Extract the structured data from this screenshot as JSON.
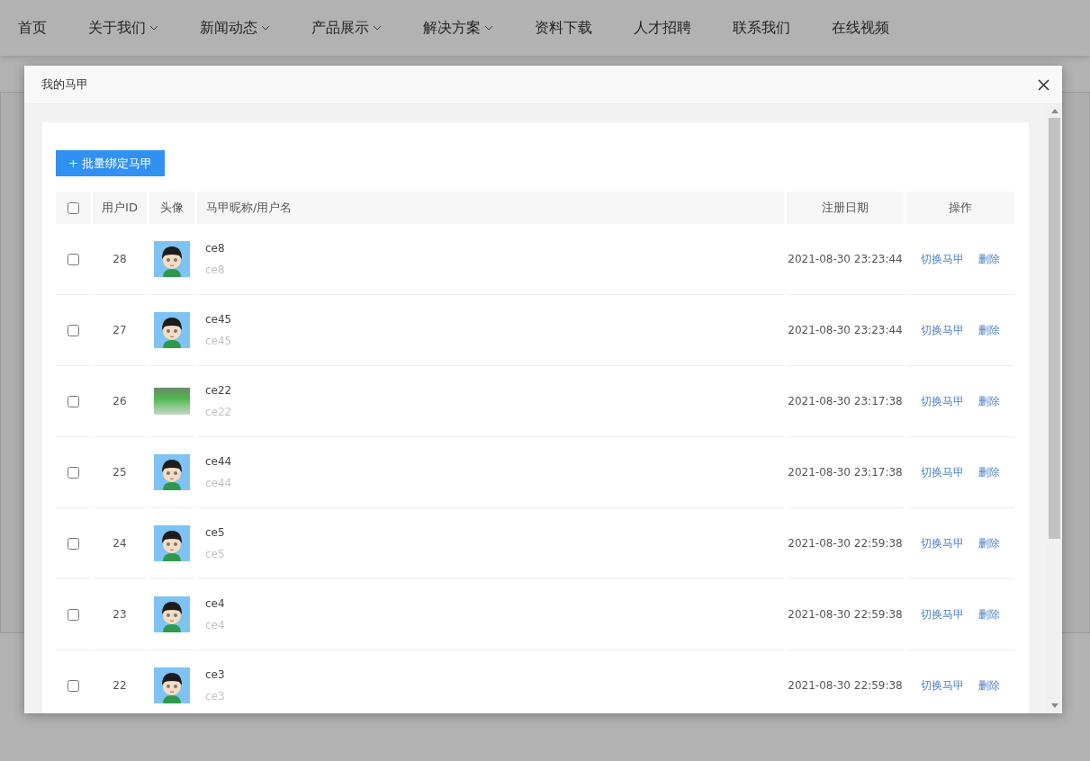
{
  "nav": [
    {
      "label": "首页",
      "dropdown": false
    },
    {
      "label": "关于我们",
      "dropdown": true
    },
    {
      "label": "新闻动态",
      "dropdown": true
    },
    {
      "label": "产品展示",
      "dropdown": true
    },
    {
      "label": "解决方案",
      "dropdown": true
    },
    {
      "label": "资料下载",
      "dropdown": false
    },
    {
      "label": "人才招聘",
      "dropdown": false
    },
    {
      "label": "联系我们",
      "dropdown": false
    },
    {
      "label": "在线视频",
      "dropdown": false
    }
  ],
  "dialog": {
    "title": "我的马甲",
    "add_button": "+ 批量绑定马甲",
    "table": {
      "select_all": {
        "checked": false
      },
      "columns": [
        "用户ID",
        "头像",
        "马甲昵称/用户名",
        "注册日期",
        "操作"
      ],
      "rows": [
        {
          "checked": false,
          "id": "28",
          "kind": "cartoon",
          "nickname": "ce8",
          "username": "ce8",
          "date": "2021-08-30 23:23:44",
          "actions": [
            "切换马甲",
            "删除"
          ]
        },
        {
          "checked": false,
          "id": "27",
          "kind": "cartoon",
          "nickname": "ce45",
          "username": "ce45",
          "date": "2021-08-30 23:23:44",
          "actions": [
            "切换马甲",
            "删除"
          ]
        },
        {
          "checked": false,
          "id": "26",
          "kind": "photo",
          "nickname": "ce22",
          "username": "ce22",
          "date": "2021-08-30 23:17:38",
          "actions": [
            "切换马甲",
            "删除"
          ]
        },
        {
          "checked": false,
          "id": "25",
          "kind": "cartoon",
          "nickname": "ce44",
          "username": "ce44",
          "date": "2021-08-30 23:17:38",
          "actions": [
            "切换马甲",
            "删除"
          ]
        },
        {
          "checked": false,
          "id": "24",
          "kind": "cartoon",
          "nickname": "ce5",
          "username": "ce5",
          "date": "2021-08-30 22:59:38",
          "actions": [
            "切换马甲",
            "删除"
          ]
        },
        {
          "checked": false,
          "id": "23",
          "kind": "cartoon",
          "nickname": "ce4",
          "username": "ce4",
          "date": "2021-08-30 22:59:38",
          "actions": [
            "切换马甲",
            "删除"
          ]
        },
        {
          "checked": false,
          "id": "22",
          "kind": "cartoon",
          "nickname": "ce3",
          "username": "ce3",
          "date": "2021-08-30 22:59:38",
          "actions": [
            "切换马甲",
            "删除"
          ]
        }
      ]
    }
  }
}
